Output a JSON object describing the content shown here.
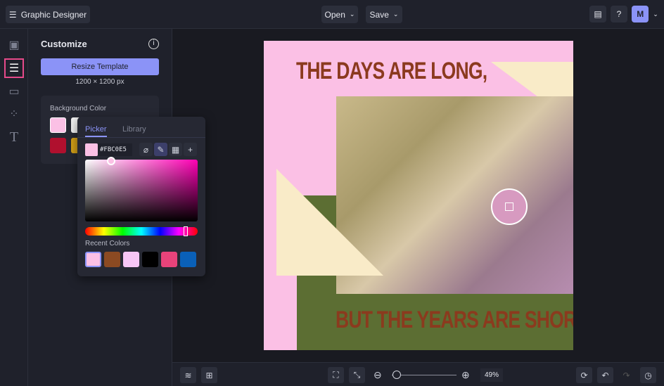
{
  "app": {
    "title": "Graphic Designer",
    "open": "Open",
    "save": "Save",
    "avatar": "M"
  },
  "panel": {
    "title": "Customize",
    "resize": "Resize Template",
    "size": "1200 × 1200 px",
    "bg_label": "Background Color",
    "bg_swatches": [
      "#fbc0e5",
      "#f2f2f2",
      "#b0102e",
      "#d4a017"
    ]
  },
  "picker": {
    "tabs": [
      "Picker",
      "Library"
    ],
    "hex": "#FBC0E5",
    "recent_label": "Recent Colors",
    "recent": [
      "#fbc0e5",
      "#8b4a22",
      "#f7c6f5",
      "#000000",
      "#e8437a",
      "#0a60b8"
    ]
  },
  "canvas": {
    "top_text": "THE DAYS ARE LONG,",
    "bottom_text": "BUT THE YEARS ARE SHORT.",
    "colors": {
      "pink": "#fbc0e5",
      "green": "#5c6e33",
      "cream": "#f9ebc8",
      "text": "#8b3a1e"
    }
  },
  "zoom": {
    "value": "49%",
    "fraction": 0.49
  }
}
